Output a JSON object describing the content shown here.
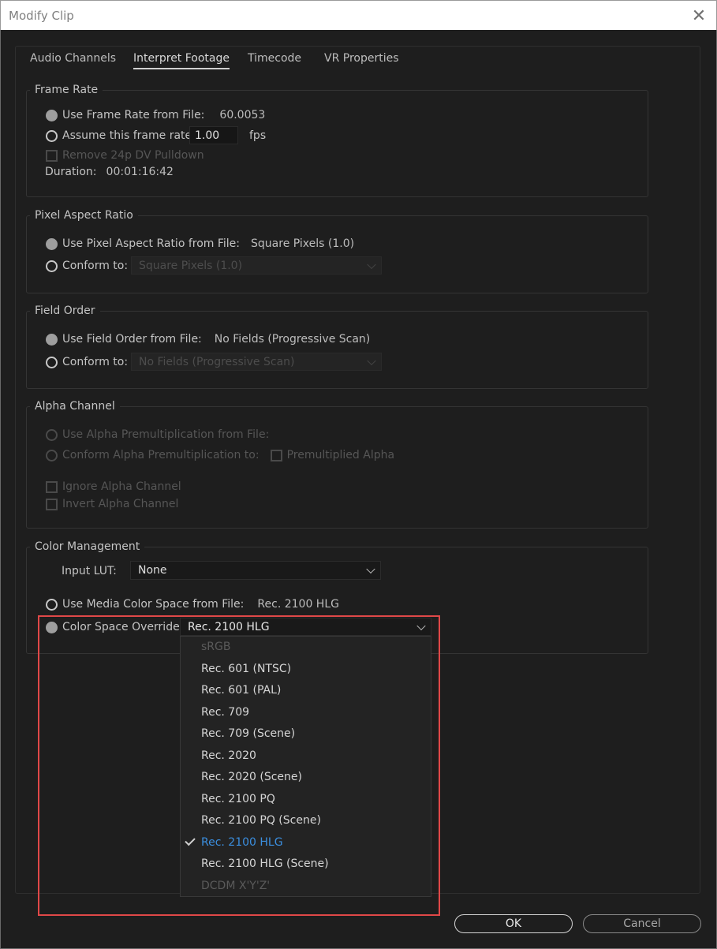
{
  "window": {
    "title": "Modify Clip",
    "close_glyph": "✕"
  },
  "tabs": [
    {
      "label": "Audio Channels"
    },
    {
      "label": "Interpret Footage"
    },
    {
      "label": "Timecode"
    },
    {
      "label": "VR Properties"
    }
  ],
  "frame_rate": {
    "title": "Frame Rate",
    "use_file_label": "Use Frame Rate from File:",
    "use_file_value": "60.0053",
    "assume_label": "Assume this frame rate:",
    "assume_value": "1.00",
    "fps_label": "fps",
    "remove_pulldown_label": "Remove 24p DV Pulldown",
    "duration_label": "Duration:",
    "duration_value": "00:01:16:42"
  },
  "pixel_aspect": {
    "title": "Pixel Aspect Ratio",
    "use_file_label": "Use Pixel Aspect Ratio from File:",
    "use_file_value": "Square Pixels (1.0)",
    "conform_label": "Conform to:",
    "conform_value": "Square Pixels (1.0)"
  },
  "field_order": {
    "title": "Field Order",
    "use_file_label": "Use Field Order from File:",
    "use_file_value": "No Fields (Progressive Scan)",
    "conform_label": "Conform to:",
    "conform_value": "No Fields (Progressive Scan)"
  },
  "alpha": {
    "title": "Alpha Channel",
    "use_file_label": "Use Alpha Premultiplication from File:",
    "conform_label": "Conform Alpha Premultiplication to:",
    "premultiplied_label": "Premultiplied Alpha",
    "ignore_label": "Ignore Alpha Channel",
    "invert_label": "Invert Alpha Channel"
  },
  "color": {
    "title": "Color Management",
    "input_lut_label": "Input LUT:",
    "input_lut_value": "None",
    "use_media_label": "Use Media Color Space from File:",
    "use_media_value": "Rec. 2100 HLG",
    "override_label": "Color Space Override:",
    "override_value": "Rec. 2100 HLG"
  },
  "dropdown_options": [
    {
      "label": "sRGB",
      "state": "disabled"
    },
    {
      "label": "Rec. 601 (NTSC)",
      "state": "normal"
    },
    {
      "label": "Rec. 601 (PAL)",
      "state": "normal"
    },
    {
      "label": "Rec. 709",
      "state": "normal"
    },
    {
      "label": "Rec. 709 (Scene)",
      "state": "normal"
    },
    {
      "label": "Rec. 2020",
      "state": "normal"
    },
    {
      "label": "Rec. 2020 (Scene)",
      "state": "normal"
    },
    {
      "label": "Rec. 2100 PQ",
      "state": "normal"
    },
    {
      "label": "Rec. 2100 PQ (Scene)",
      "state": "normal"
    },
    {
      "label": "Rec. 2100 HLG",
      "state": "selected"
    },
    {
      "label": "Rec. 2100 HLG (Scene)",
      "state": "normal"
    },
    {
      "label": "DCDM X'Y'Z'",
      "state": "disabled"
    }
  ],
  "buttons": {
    "ok": "OK",
    "cancel": "Cancel"
  },
  "colors": {
    "selected_item": "#3b8fe0",
    "highlight_box": "#e04848"
  }
}
